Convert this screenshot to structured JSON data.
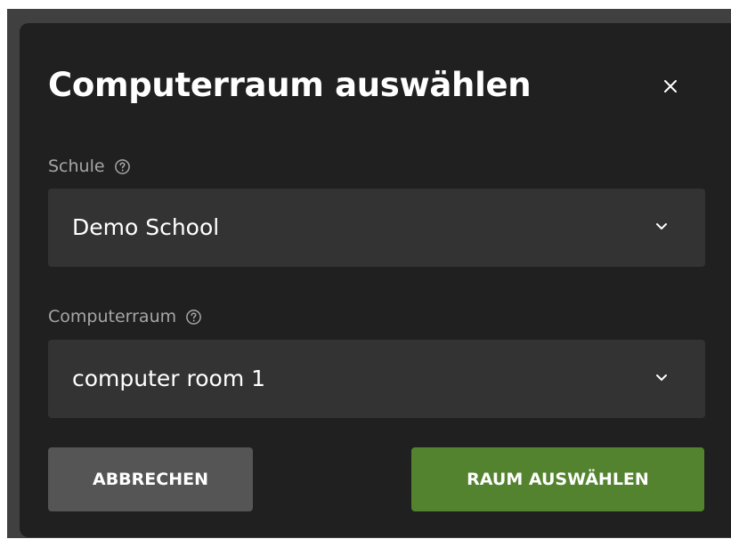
{
  "dialog": {
    "title": "Computerraum auswählen",
    "close_icon": "close-icon"
  },
  "school_field": {
    "label": "Schule",
    "help_icon": "help-circle-icon",
    "value": "Demo School",
    "dropdown_icon": "chevron-down-icon"
  },
  "room_field": {
    "label": "Computerraum",
    "help_icon": "help-circle-icon",
    "value": "computer room 1",
    "dropdown_icon": "chevron-down-icon"
  },
  "actions": {
    "cancel_label": "ABBRECHEN",
    "select_label": "RAUM AUSWÄHLEN"
  },
  "colors": {
    "background": "#404040",
    "dialog": "#202020",
    "field": "#333333",
    "cancel_button": "#555555",
    "primary_button": "#548330",
    "label_text": "#a6a6a6",
    "text": "#ffffff"
  }
}
